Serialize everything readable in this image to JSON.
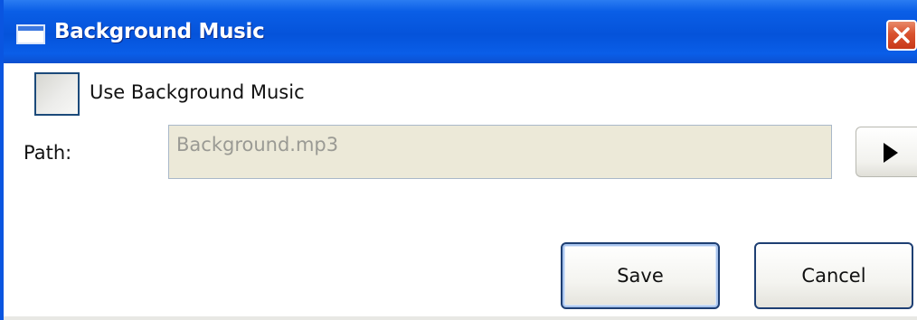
{
  "window": {
    "title": "Background Music"
  },
  "form": {
    "use_music_label": "Use Background Music",
    "use_music_checked": false,
    "path_label": "Path:",
    "path_value": "Background.mp3"
  },
  "buttons": {
    "save_label": "Save",
    "cancel_label": "Cancel"
  },
  "icons": {
    "app": "window-icon",
    "close": "close-icon",
    "browse": "play-icon"
  },
  "colors": {
    "titlebar": "#0553da",
    "close_button": "#d9522e",
    "input_background": "#ece9d8",
    "button_border": "#1e3f73"
  }
}
